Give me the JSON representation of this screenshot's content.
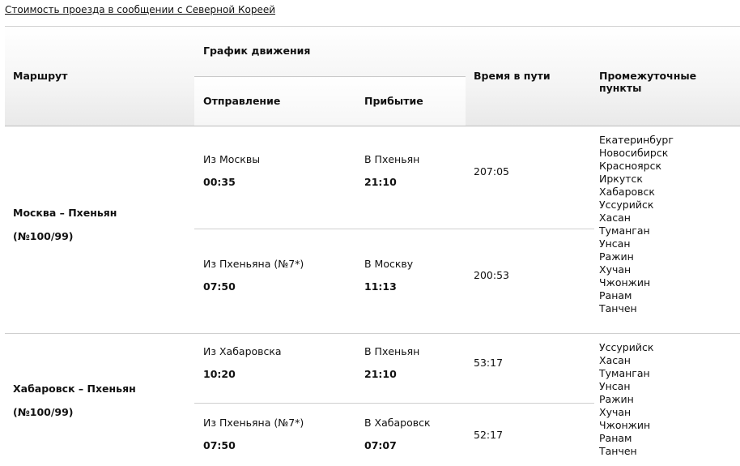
{
  "top_link": "Стоимость проезда в сообщении с Северной Кореей",
  "headers": {
    "route": "Маршрут",
    "schedule": "График движения",
    "departure": "Отправление",
    "arrival": "Прибытие",
    "travel_time": "Время в пути",
    "stops": "Промежуточные пункты"
  },
  "routes": [
    {
      "name": "Москва – Пхеньян",
      "number": "(№100/99)",
      "trips": [
        {
          "dep_label": "Из Москвы",
          "dep_time": "00:35",
          "arr_label": "В Пхеньян",
          "arr_time": "21:10",
          "duration": "207:05"
        },
        {
          "dep_label": "Из Пхеньяна (№7*)",
          "dep_time": "07:50",
          "arr_label": "В Москву",
          "arr_time": "11:13",
          "duration": "200:53"
        }
      ],
      "stops": [
        "Екатеринбург",
        "Новосибирск",
        "Красноярск",
        "Иркутск",
        "Хабаровск",
        "Уссурийск",
        "Хасан",
        "Туманган",
        "Унсан",
        "Ражин",
        "Хучан",
        "Чжонжин",
        "Ранам",
        "Танчен"
      ]
    },
    {
      "name": "Хабаровск – Пхеньян",
      "number": "(№100/99)",
      "trips": [
        {
          "dep_label": "Из Хабаровска",
          "dep_time": "10:20",
          "arr_label": "В Пхеньян",
          "arr_time": "21:10",
          "duration": "53:17"
        },
        {
          "dep_label": "Из Пхеньяна (№7*)",
          "dep_time": "07:50",
          "arr_label": "В Хабаровск",
          "arr_time": "07:07",
          "duration": "52:17"
        }
      ],
      "stops": [
        "Уссурийск",
        "Хасан",
        "Туманган",
        "Унсан",
        "Ражин",
        "Хучан",
        "Чжонжин",
        "Ранам",
        "Танчен"
      ]
    }
  ]
}
